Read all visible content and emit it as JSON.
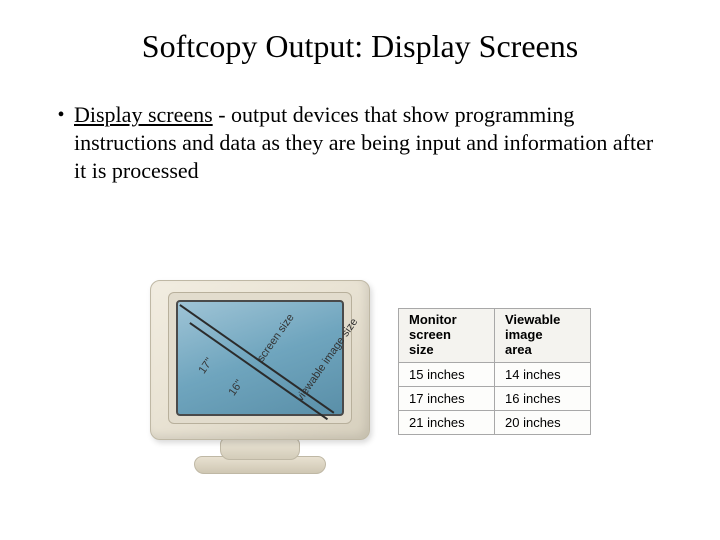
{
  "title": "Softcopy Output:  Display Screens",
  "bullet": {
    "term": "Display screens",
    "rest": " - output devices that show programming instructions and data as they are being input and information after it is processed"
  },
  "monitor": {
    "diag_outer_size": "17\"",
    "diag_outer_label": "screen size",
    "diag_inner_size": "16\"",
    "diag_inner_label": "viewable image size"
  },
  "table": {
    "head_col1_line1": "Monitor",
    "head_col1_line2": "screen",
    "head_col1_line3": "size",
    "head_col2_line1": "Viewable",
    "head_col2_line2": "image",
    "head_col2_line3": "area",
    "rows": [
      {
        "c1": "15 inches",
        "c2": "14 inches"
      },
      {
        "c1": "17 inches",
        "c2": "16 inches"
      },
      {
        "c1": "21 inches",
        "c2": "20 inches"
      }
    ]
  }
}
